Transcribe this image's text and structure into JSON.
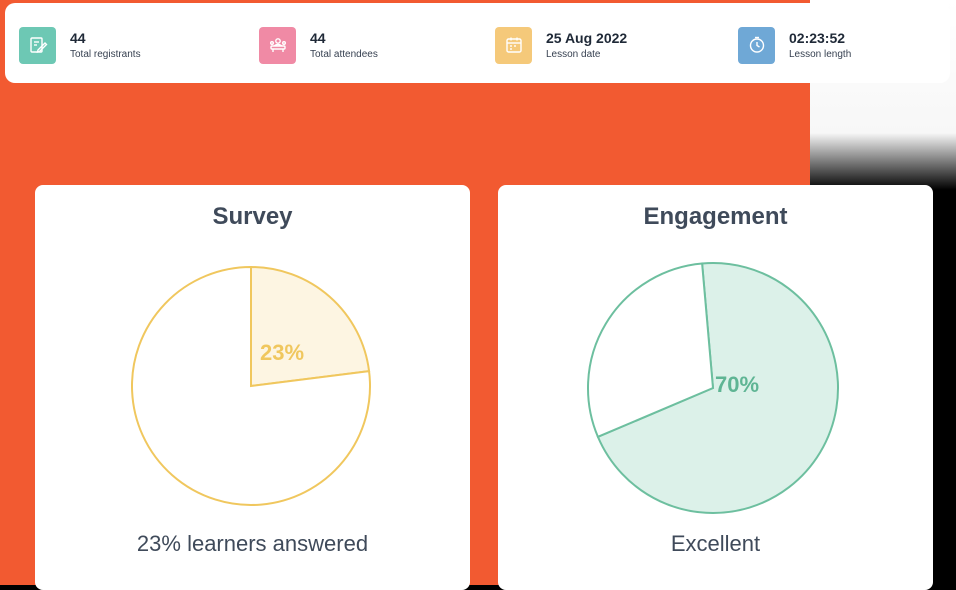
{
  "stats": [
    {
      "value": "44",
      "label": "Total registrants",
      "icon": "clipboard-edit-icon",
      "color": "#6dc8b4"
    },
    {
      "value": "44",
      "label": "Total attendees",
      "icon": "attendees-icon",
      "color": "#f08aa5"
    },
    {
      "value": "25 Aug 2022",
      "label": "Lesson date",
      "icon": "calendar-icon",
      "color": "#f5c97a"
    },
    {
      "value": "02:23:52",
      "label": "Lesson length",
      "icon": "clock-icon",
      "color": "#6fa8d6"
    }
  ],
  "survey": {
    "title": "Survey",
    "percent_label": "23%",
    "caption": "23% learners answered",
    "accent": "#f0c75e"
  },
  "engagement": {
    "title": "Engagement",
    "percent_label": "70%",
    "caption": "Excellent",
    "accent": "#6dbf9f"
  },
  "chart_data": [
    {
      "type": "pie",
      "title": "Survey",
      "values": [
        23,
        77
      ],
      "highlighted": 0
    },
    {
      "type": "pie",
      "title": "Engagement",
      "values": [
        70,
        30
      ],
      "highlighted": 0
    }
  ]
}
